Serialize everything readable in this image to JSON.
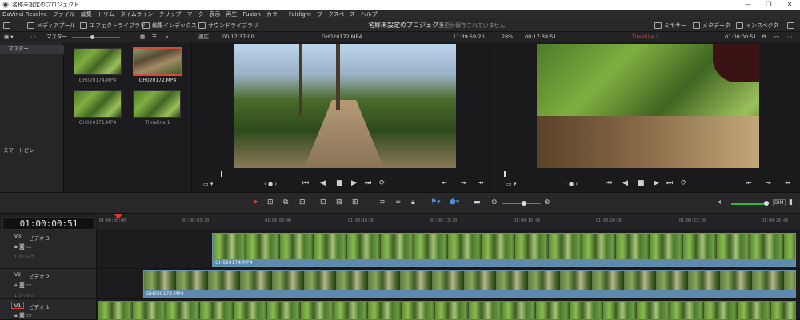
{
  "titlebar": {
    "title": "名称未設定のプロジェクト"
  },
  "menu": [
    "DaVinci Resolve",
    "ファイル",
    "編集",
    "トリム",
    "タイムライン",
    "クリップ",
    "マーク",
    "表示",
    "再生",
    "Fusion",
    "カラー",
    "Fairlight",
    "ワークスペース",
    "ヘルプ"
  ],
  "toolbar": {
    "media_pool": "メディアプール",
    "effects_library": "エフェクトライブラリ",
    "edit_index": "編集インデックス",
    "sound_library": "サウンドライブラリ",
    "project_name": "名称未設定のプロジェクト",
    "save_status": "変更が保存されていません",
    "mixer": "ミキサー",
    "metadata": "メタデータ",
    "inspector": "インスペクタ"
  },
  "subbar": {
    "bin": "マスター",
    "fit": "適応",
    "left_tc": "00:17:37:00",
    "left_clip": "GH020172.MP4",
    "left_dur": "11:39:59:20",
    "zoom": "28%",
    "right_tc": "00:17:38:51",
    "right_name": "Timeline 1",
    "right_end": "01:00:00:51"
  },
  "sidebar": {
    "master": "マスター",
    "smart_bins": "スマートビン"
  },
  "media": [
    {
      "label": "GH020174.MP4"
    },
    {
      "label": "GH020172.MP4"
    },
    {
      "label": "GH020171.MP4"
    },
    {
      "label": "Timeline 1"
    }
  ],
  "timeline": {
    "timecode": "01:00:00:51",
    "ticks": [
      "01:00:00:00",
      "01:00:03:20",
      "01:00:06:40",
      "01:00:10:00",
      "01:00:13:20",
      "01:00:16:40",
      "01:00:20:00",
      "01:00:23:20",
      "01:00:26:40"
    ],
    "tracks": [
      {
        "id": "V3",
        "name": "ビデオ 3",
        "count": "1 クリップ",
        "clip": "GH020174.MP4"
      },
      {
        "id": "V2",
        "name": "ビデオ 2",
        "count": "1 クリップ",
        "clip": "GH020172.MP4"
      },
      {
        "id": "V1",
        "name": "ビデオ 1"
      }
    ]
  },
  "colors": {
    "accent": "#d24b3c",
    "clip": "#5e8ab0",
    "playhead": "#d93a2b"
  }
}
